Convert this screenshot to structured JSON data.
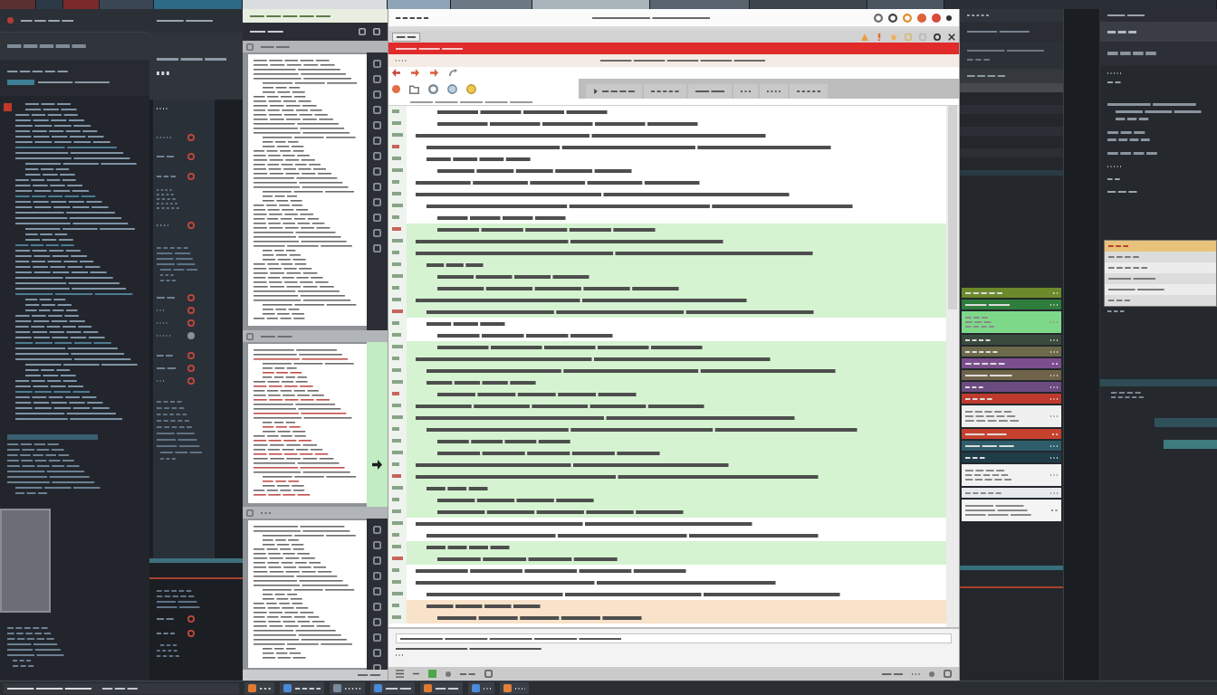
{
  "editor": {
    "lines": [
      {
        "kind": "plain"
      },
      {
        "kind": "plain"
      },
      {
        "kind": "plain"
      },
      {
        "kind": "plain"
      },
      {
        "kind": "plain"
      },
      {
        "kind": "plain"
      },
      {
        "kind": "plain"
      },
      {
        "kind": "plain"
      },
      {
        "kind": "plain"
      },
      {
        "kind": "plain"
      },
      {
        "kind": "added"
      },
      {
        "kind": "added"
      },
      {
        "kind": "added"
      },
      {
        "kind": "added"
      },
      {
        "kind": "added"
      },
      {
        "kind": "added"
      },
      {
        "kind": "added"
      },
      {
        "kind": "added"
      },
      {
        "kind": "plain"
      },
      {
        "kind": "plain"
      },
      {
        "kind": "added"
      },
      {
        "kind": "added"
      },
      {
        "kind": "added"
      },
      {
        "kind": "added"
      },
      {
        "kind": "added"
      },
      {
        "kind": "added"
      },
      {
        "kind": "added"
      },
      {
        "kind": "added"
      },
      {
        "kind": "added"
      },
      {
        "kind": "added"
      },
      {
        "kind": "added"
      },
      {
        "kind": "added"
      },
      {
        "kind": "added"
      },
      {
        "kind": "added"
      },
      {
        "kind": "added"
      },
      {
        "kind": "plain"
      },
      {
        "kind": "plain"
      },
      {
        "kind": "added"
      },
      {
        "kind": "added"
      },
      {
        "kind": "plain"
      },
      {
        "kind": "plain"
      },
      {
        "kind": "plain"
      },
      {
        "kind": "changed"
      },
      {
        "kind": "changed"
      }
    ]
  },
  "tracks": [
    {
      "kind": "row",
      "color": "#6b8a2c"
    },
    {
      "kind": "row",
      "color": "#2f7d3d"
    },
    {
      "kind": "tall",
      "color": "#7ed889"
    },
    {
      "kind": "row",
      "color": "#3a4a3d"
    },
    {
      "kind": "row",
      "color": "#6d6a4b"
    },
    {
      "kind": "row",
      "color": "#7c4e8d"
    },
    {
      "kind": "row",
      "color": "#6f6349"
    },
    {
      "kind": "row",
      "color": "#6c4b80"
    },
    {
      "kind": "row",
      "color": "#bf3a2c"
    },
    {
      "kind": "tall",
      "color": "#f0f0f0"
    },
    {
      "kind": "row",
      "color": "#c8412f"
    },
    {
      "kind": "row",
      "color": "#2e5d6b"
    },
    {
      "kind": "row",
      "color": "#1f3c49"
    },
    {
      "kind": "tall",
      "color": "#f2f2f2"
    },
    {
      "kind": "row",
      "color": "#e6eaed"
    },
    {
      "kind": "tall",
      "color": "#f4f4f4"
    }
  ],
  "dropdown": {
    "items": [
      {
        "selected": true
      },
      {
        "selected": false
      },
      {
        "selected": false
      },
      {
        "selected": false
      },
      {
        "selected": false
      },
      {
        "selected": false
      }
    ]
  }
}
